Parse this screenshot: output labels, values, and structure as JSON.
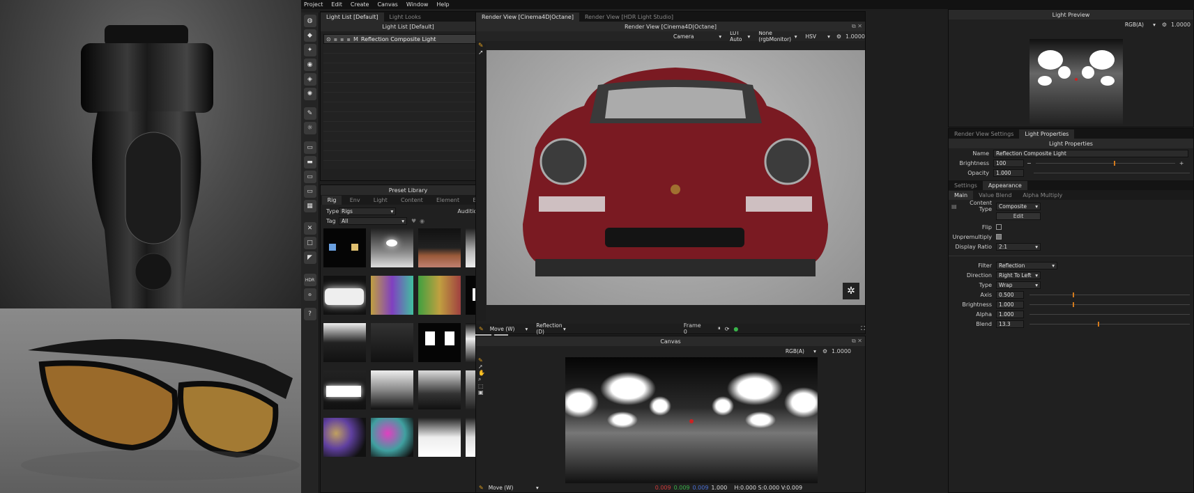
{
  "menu": [
    "Project",
    "Edit",
    "Create",
    "Canvas",
    "Window",
    "Help"
  ],
  "light_list": {
    "tabs": [
      "Light List [Default]",
      "Light Looks"
    ],
    "title": "Light List [Default]",
    "item_label": "Reflection Composite Light"
  },
  "preset_library": {
    "title": "Preset Library",
    "tabs": [
      "Rig",
      "Env",
      "Light",
      "Content",
      "Element",
      "Effect"
    ],
    "type_label": "Type",
    "type_value": "Rigs",
    "tag_label": "Tag",
    "tag_value": "All",
    "audition_label": "Audition"
  },
  "render_view": {
    "tabs": [
      "Render View [Cinema4D|Octane]",
      "Render View [HDR Light Studio]"
    ],
    "title": "Render View [Cinema4D|Octane]",
    "camera": "Camera",
    "lut": "LUT Auto",
    "colorspace": "None (rgbMonitor)",
    "mode": "HSV",
    "value": "1.0000",
    "move_mode": "Move (W)",
    "reflection": "Reflection (D)",
    "frame": "Frame 0"
  },
  "canvas": {
    "title": "Canvas",
    "channel": "RGB(A)",
    "value": "1.0000",
    "move_mode": "Move (W)",
    "pixel_r": "0.009",
    "pixel_g": "0.009",
    "pixel_b": "0.009",
    "pixel_a": "1.000",
    "hsv": "H:0.000 S:0.000 V:0.009"
  },
  "light_preview": {
    "title": "Light Preview",
    "channel": "RGB(A)",
    "value": "1.0000"
  },
  "properties": {
    "tabs": [
      "Render View Settings",
      "Light Properties"
    ],
    "title": "Light Properties",
    "name_label": "Name",
    "name_value": "Reflection Composite Light",
    "brightness_label": "Brightness",
    "brightness_value": "100",
    "opacity_label": "Opacity",
    "opacity_value": "1.000",
    "subtabs": [
      "Settings",
      "Appearance"
    ],
    "subsubtabs": [
      "Main",
      "Value Blend",
      "Alpha Multiply"
    ],
    "content_type_label": "Content Type",
    "content_type_value": "Composite",
    "edit_button": "Edit",
    "flip_label": "Flip",
    "unpremultiply_label": "Unpremultiply",
    "display_ratio_label": "Display Ratio",
    "display_ratio_value": "2:1",
    "filter_label": "Filter",
    "filter_value": "Reflection",
    "direction_label": "Direction",
    "direction_value": "Right To Left",
    "type_label": "Type",
    "type_value": "Wrap",
    "axis_label": "Axis",
    "axis_value": "0.500",
    "brightness2_label": "Brightness",
    "brightness2_value": "1.000",
    "alpha_label": "Alpha",
    "alpha_value": "1.000",
    "blend_label": "Blend",
    "blend_value": "13.3"
  },
  "colors": {
    "accent": "#d47a1c",
    "car": "#7a1a22",
    "background": "#1e1e1e",
    "red_text": "#d23b3b",
    "green_text": "#39b54a",
    "blue_text": "#4a6fd6"
  }
}
